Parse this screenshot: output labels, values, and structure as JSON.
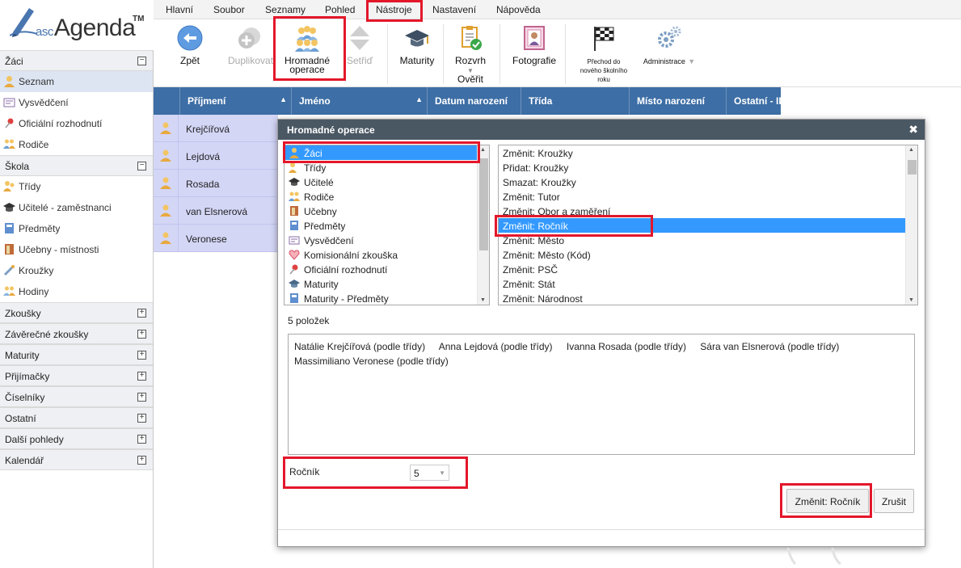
{
  "logo": {
    "asc": "asc",
    "agenda": "Agenda",
    "tm": "TM"
  },
  "menu": [
    "Hlavní",
    "Soubor",
    "Seznamy",
    "Pohled",
    "Nástroje",
    "Nastavení",
    "Nápověda"
  ],
  "toolbar": {
    "zpet": "Zpět",
    "duplikovat": "Duplikovat",
    "hromadne_1": "Hromadné",
    "hromadne_2": "operace",
    "setrid": "Setřiď",
    "maturity": "Maturity",
    "rozvrh_1": "Rozvrh",
    "rozvrh_2": "Ověřit",
    "fotografie": "Fotografie",
    "prechod_1": "Přechod do",
    "prechod_2": "nového školního",
    "prechod_3": "roku",
    "administrace": "Administrace"
  },
  "sidebar": {
    "zaci": "Žáci",
    "zaci_items": [
      "Seznam",
      "Vysvědčení",
      "Oficiální rozhodnutí",
      "Rodiče"
    ],
    "skola": "Škola",
    "skola_items": [
      "Třídy",
      "Učitelé - zaměstnanci",
      "Předměty",
      "Učebny - místnosti",
      "Kroužky",
      "Hodiny"
    ],
    "collapsed": [
      "Zkoušky",
      "Závěrečné zkoušky",
      "Maturity",
      "Přijímačky",
      "Číselníky",
      "Ostatní",
      "Další pohledy",
      "Kalendář"
    ]
  },
  "grid": {
    "columns": [
      "Příjmení",
      "Jméno",
      "Datum narození",
      "Třída",
      "Místo narození",
      "Ostatní - II"
    ],
    "rows": [
      "Krejčířová",
      "Lejdová",
      "Rosada",
      "van Elsnerová",
      "Veronese"
    ]
  },
  "dialog": {
    "title": "Hromadné operace",
    "close": "✖",
    "left_items": [
      "Žáci",
      "Třídy",
      "Učitelé",
      "Rodiče",
      "Učebny",
      "Předměty",
      "Vysvědčení",
      "Komisionální zkouška",
      "Oficiální rozhodnutí",
      "Maturity",
      "Maturity - Předměty"
    ],
    "right_items": [
      "Změnit: Kroužky",
      "Přidat: Kroužky",
      "Smazat: Kroužky",
      "Změnit: Tutor",
      "Změnit: Obor a zaměření",
      "Změnit: Ročník",
      "Změnit: Město",
      "Změnit: Město (Kód)",
      "Změnit: PSČ",
      "Změnit: Stát",
      "Změnit: Národnost"
    ],
    "count": "5 položek",
    "selected": [
      "Natálie Krejčířová (podle třídy)",
      "Anna Lejdová (podle třídy)",
      "Ivanna Rosada (podle třídy)",
      "Sára van Elsnerová (podle třídy)",
      "Massimiliano Veronese (podle třídy)"
    ],
    "rocnik_label": "Ročník",
    "rocnik_value": "5",
    "apply_button": "Změnit: Ročník",
    "cancel_button": "Zrušit"
  },
  "colors": {
    "accent": "#3d6ea5",
    "highlight": "#e3172a",
    "selection": "#3399ff",
    "row_bg": "#d4d6f6",
    "dialog_title": "#4a5864"
  }
}
